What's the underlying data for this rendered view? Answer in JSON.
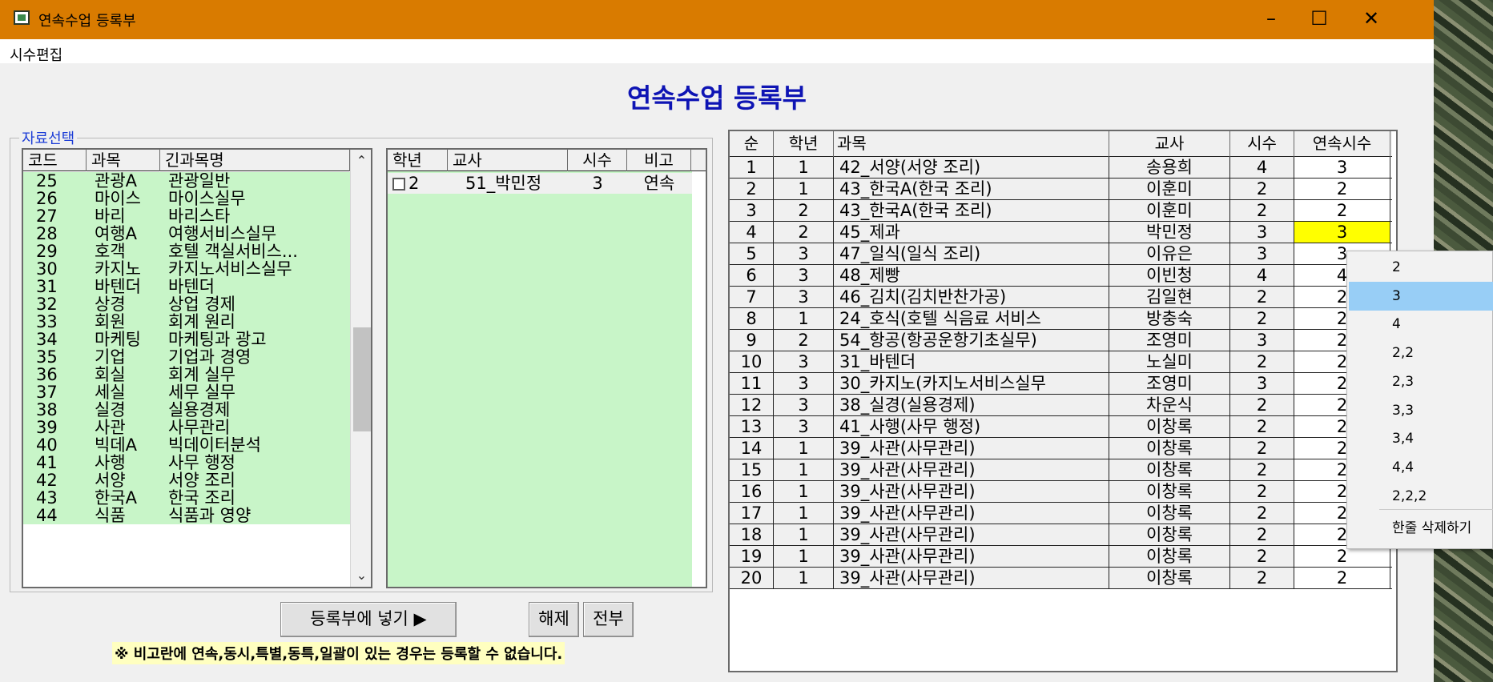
{
  "window": {
    "title": "연속수업 등록부",
    "controls": [
      "–",
      "☐",
      "✕"
    ]
  },
  "menu": {
    "item": "시수편집"
  },
  "header": {
    "title": "연속수업 등록부"
  },
  "group": {
    "label": "자료선택"
  },
  "left_grid": {
    "headers": [
      "코드",
      "과목",
      "긴과목명"
    ],
    "rows": [
      [
        "25",
        "관광A",
        "관광일반"
      ],
      [
        "26",
        "마이스",
        "마이스실무"
      ],
      [
        "27",
        "바리",
        "바리스타"
      ],
      [
        "28",
        "여행A",
        "여행서비스실무"
      ],
      [
        "29",
        "호객",
        "호텔 객실서비스..."
      ],
      [
        "30",
        "카지노",
        "카지노서비스실무"
      ],
      [
        "31",
        "바텐더",
        "바텐더"
      ],
      [
        "32",
        "상경",
        "상업 경제"
      ],
      [
        "33",
        "회원",
        "회계 원리"
      ],
      [
        "34",
        "마케팅",
        "마케팅과 광고"
      ],
      [
        "35",
        "기업",
        "기업과 경영"
      ],
      [
        "36",
        "회실",
        "회계 실무"
      ],
      [
        "37",
        "세실",
        "세무 실무"
      ],
      [
        "38",
        "실경",
        "실용경제"
      ],
      [
        "39",
        "사관",
        "사무관리"
      ],
      [
        "40",
        "빅데A",
        "빅데이터분석"
      ],
      [
        "41",
        "사행",
        "사무 행정"
      ],
      [
        "42",
        "서양",
        "서양 조리"
      ],
      [
        "43",
        "한국A",
        "한국 조리"
      ],
      [
        "44",
        "식품",
        "식품과 영양"
      ]
    ]
  },
  "mid_grid": {
    "headers": [
      "학년",
      "교사",
      "시수",
      "비고"
    ],
    "rows": [
      [
        "2",
        "51_박민정",
        "3",
        "연속"
      ]
    ]
  },
  "right_grid": {
    "headers": [
      "순",
      "학년",
      "과목",
      "교사",
      "시수",
      "연속시수"
    ],
    "rows": [
      [
        "1",
        "1",
        "42_서양(서양 조리)",
        "송용희",
        "4",
        "3"
      ],
      [
        "2",
        "1",
        "43_한국A(한국 조리)",
        "이훈미",
        "2",
        "2"
      ],
      [
        "3",
        "2",
        "43_한국A(한국 조리)",
        "이훈미",
        "2",
        "2"
      ],
      [
        "4",
        "2",
        "45_제과",
        "박민정",
        "3",
        "3"
      ],
      [
        "5",
        "3",
        "47_일식(일식 조리)",
        "이유은",
        "3",
        "3"
      ],
      [
        "6",
        "3",
        "48_제빵",
        "이빈청",
        "4",
        "4"
      ],
      [
        "7",
        "3",
        "46_김치(김치반찬가공)",
        "김일현",
        "2",
        "2"
      ],
      [
        "8",
        "1",
        "24_호식(호텔 식음료 서비스",
        "방충숙",
        "2",
        "2"
      ],
      [
        "9",
        "2",
        "54_항공(항공운항기초실무)",
        "조영미",
        "3",
        "2"
      ],
      [
        "10",
        "3",
        "31_바텐더",
        "노실미",
        "2",
        "2"
      ],
      [
        "11",
        "3",
        "30_카지노(카지노서비스실무",
        "조영미",
        "3",
        "2"
      ],
      [
        "12",
        "3",
        "38_실경(실용경제)",
        "차운식",
        "2",
        "2"
      ],
      [
        "13",
        "3",
        "41_사행(사무 행정)",
        "이창록",
        "2",
        "2"
      ],
      [
        "14",
        "1",
        "39_사관(사무관리)",
        "이창록",
        "2",
        "2"
      ],
      [
        "15",
        "1",
        "39_사관(사무관리)",
        "이창록",
        "2",
        "2"
      ],
      [
        "16",
        "1",
        "39_사관(사무관리)",
        "이창록",
        "2",
        "2"
      ],
      [
        "17",
        "1",
        "39_사관(사무관리)",
        "이창록",
        "2",
        "2"
      ],
      [
        "18",
        "1",
        "39_사관(사무관리)",
        "이창록",
        "2",
        "2"
      ],
      [
        "19",
        "1",
        "39_사관(사무관리)",
        "이창록",
        "2",
        "2"
      ],
      [
        "20",
        "1",
        "39_사관(사무관리)",
        "이창록",
        "2",
        "2"
      ]
    ]
  },
  "buttons": {
    "register": "등록부에 넣기 ▶",
    "release": "해제",
    "all": "전부"
  },
  "notice": "※ 비고란에 연속,동시,특별,동특,일괄이 있는 경우는 등록할  수 없습니다.",
  "context_menu": {
    "items": [
      "2",
      "3",
      "4",
      "2,2",
      "2,3",
      "3,3",
      "3,4",
      "4,4",
      "2,2,2"
    ],
    "delete": "한줄 삭제하기"
  },
  "colors": {
    "titlebar": "#d97b00",
    "grid_green": "#c8f5c8",
    "header_text": "#0e14b4",
    "selected_cell": "#ffff00",
    "menu_highlight": "#98cef6"
  }
}
